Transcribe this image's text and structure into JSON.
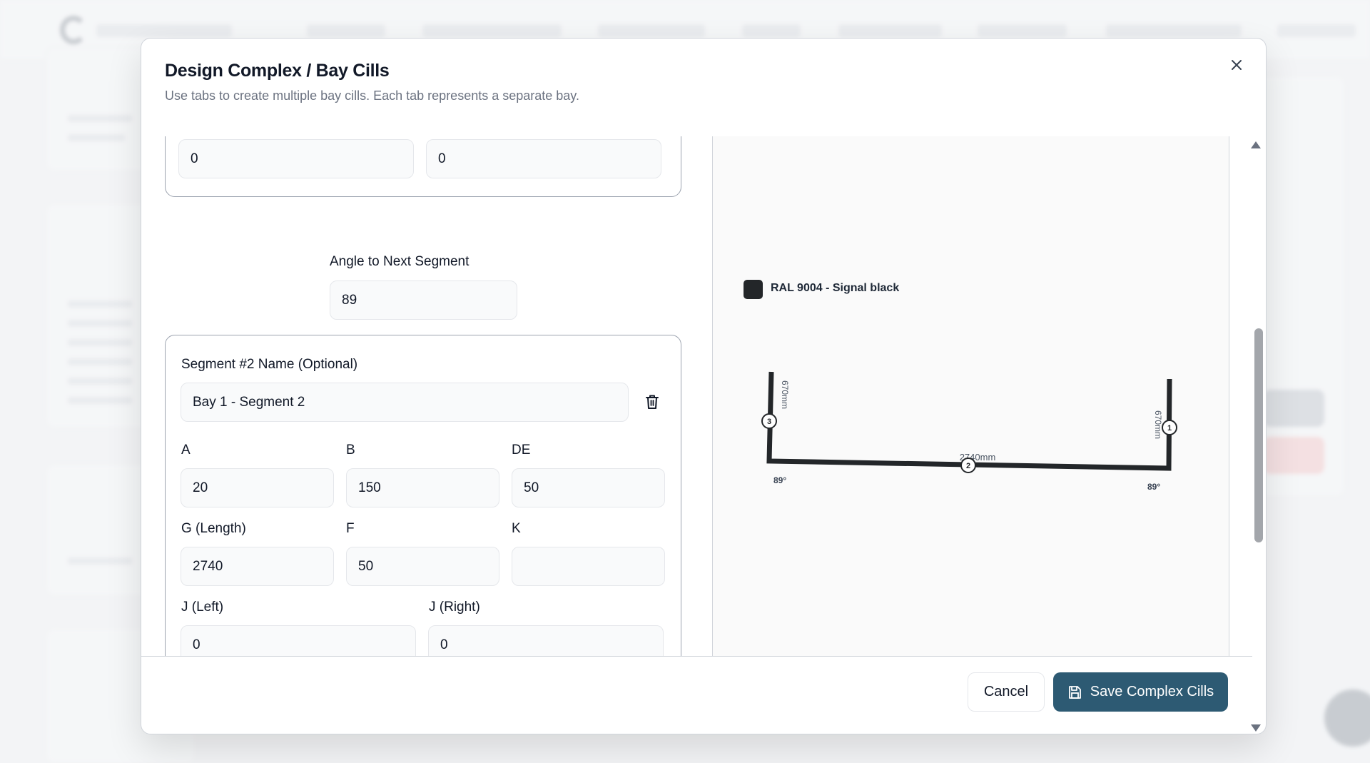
{
  "modal": {
    "title": "Design Complex / Bay Cills",
    "subtitle": "Use tabs to create multiple bay cills. Each tab represents a separate bay."
  },
  "segment1_tail": {
    "j_left_value": "0",
    "j_right_value": "0"
  },
  "angle": {
    "label": "Angle to Next Segment",
    "value": "89"
  },
  "segment2": {
    "name_label": "Segment #2 Name (Optional)",
    "name_value": "Bay 1 - Segment 2",
    "fields": {
      "a": {
        "label": "A",
        "value": "20"
      },
      "b": {
        "label": "B",
        "value": "150"
      },
      "de": {
        "label": "DE",
        "value": "50"
      },
      "g": {
        "label": "G (Length)",
        "value": "2740"
      },
      "f": {
        "label": "F",
        "value": "50"
      },
      "k": {
        "label": "K",
        "value": ""
      },
      "j_left": {
        "label": "J (Left)",
        "value": "0"
      },
      "j_right": {
        "label": "J (Right)",
        "value": "0"
      }
    }
  },
  "preview": {
    "color_name": "RAL 9004 - Signal black",
    "color_hex": "#232629",
    "dimensions": {
      "left_side": "670mm",
      "bottom": "2740mm",
      "right_side": "670mm"
    },
    "angles": {
      "left": "89°",
      "right": "89°"
    },
    "markers": [
      "1",
      "2",
      "3"
    ]
  },
  "footer": {
    "cancel_label": "Cancel",
    "save_label": "Save Complex Cills"
  },
  "icons": {
    "close": "close-icon",
    "trash": "trash-icon",
    "save": "save-icon"
  }
}
